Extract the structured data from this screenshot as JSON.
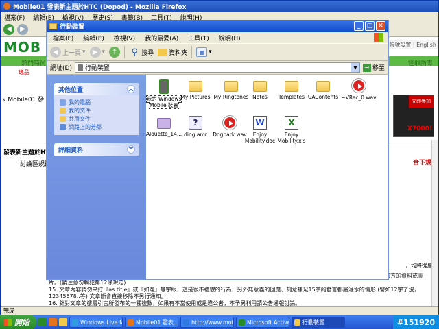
{
  "firefox": {
    "title": "Mobile01 發表新主題於HTC (Dopod) - Mozilla Firefox",
    "menu": [
      "檔案(F)",
      "編輯(E)",
      "檢視(V)",
      "歷史(S)",
      "書籤(B)",
      "工具(T)",
      "說明(H)"
    ],
    "logo": "MOB",
    "top_links": "帳號設置 | English",
    "hot_left": "熱門時尚",
    "hot_right": "怪罪防毒",
    "row2_left": "逸品",
    "row2_right": "",
    "breadcrumb": "» Mobile01 發",
    "ad_red": "立即參加",
    "ad_text": "X7000!",
    "section_head": "發表新主題於HT",
    "section_right": "合下規",
    "forum_rule": "討論區規則",
    "rule_tail": "，均將從嚴",
    "rules": [
      "14. 請不要在討論區內發表商業性質廣告或是高特定網站宣傳；如果是討論上需要也請勿能避免引用購物/拍賣網站資料或連結，請盡量使用官方的資料或圖片。(請注意勿觸犯第12條規定)",
      "15. 文章內容請勿只打『as title』或『如題』等字眼，這是很不禮貌的行為，另外無意義的回應、刻意補足15字的發言都屬灌水的情形 (譬如12字了沒，12345678..等) 文章斷會直接移除不另行通知。",
      "16. 針對文章的樓層引言所發布的一種複數，如果有不當使用或是違公者，不予另利用請公告通報討論。"
    ],
    "status": "完成"
  },
  "explorer": {
    "title": "行動裝置",
    "menu": [
      "檔案(F)",
      "編輯(E)",
      "檢視(V)",
      "我的最愛(A)",
      "工具(T)",
      "說明(H)"
    ],
    "toolbar": {
      "back": "上一頁",
      "search": "搜尋",
      "folders": "資料夾"
    },
    "address_label": "網址(D)",
    "address_value": "行動裝置",
    "go_label": "移至",
    "panels": {
      "other_places": {
        "title": "其他位置",
        "items": [
          "我的電腦",
          "我的文件",
          "共用文件",
          "網路上的芳鄰"
        ]
      },
      "details": {
        "title": "詳細資料"
      }
    },
    "items": [
      {
        "label": "我的 Windows Mobile 裝置",
        "icon": "mobile-device-icon"
      },
      {
        "label": "My Pictures",
        "icon": "folder-icon"
      },
      {
        "label": "My Ringtones",
        "icon": "folder-icon"
      },
      {
        "label": "Notes",
        "icon": "folder-icon"
      },
      {
        "label": "Templates",
        "icon": "folder-icon"
      },
      {
        "label": "UAContents",
        "icon": "folder-icon"
      },
      {
        "label": "~VRec_0.wav",
        "icon": "wav-icon"
      },
      {
        "label": "Alouette_14...",
        "icon": "folder-icon"
      },
      {
        "label": "ding.amr",
        "icon": "amr-icon"
      },
      {
        "label": "Dogbark.wav",
        "icon": "wav-icon"
      },
      {
        "label": "Enjoy Mobility.doc",
        "icon": "doc-icon"
      },
      {
        "label": "Enjoy Mobility.xls",
        "icon": "xls-icon"
      }
    ]
  },
  "taskbar": {
    "start": "開始",
    "tasks": [
      {
        "label": "Windows Live M...",
        "color": "#2f9de0"
      },
      {
        "label": "Mobile01 發表...",
        "color": "#e3731c"
      },
      {
        "label": "http://www.mobil...",
        "color": "#2f7ae0"
      },
      {
        "label": "Microsoft Active...",
        "color": "#2a8a2a"
      },
      {
        "label": "行動裝置",
        "color": "#f2c94c"
      }
    ],
    "tray": "#151920"
  }
}
